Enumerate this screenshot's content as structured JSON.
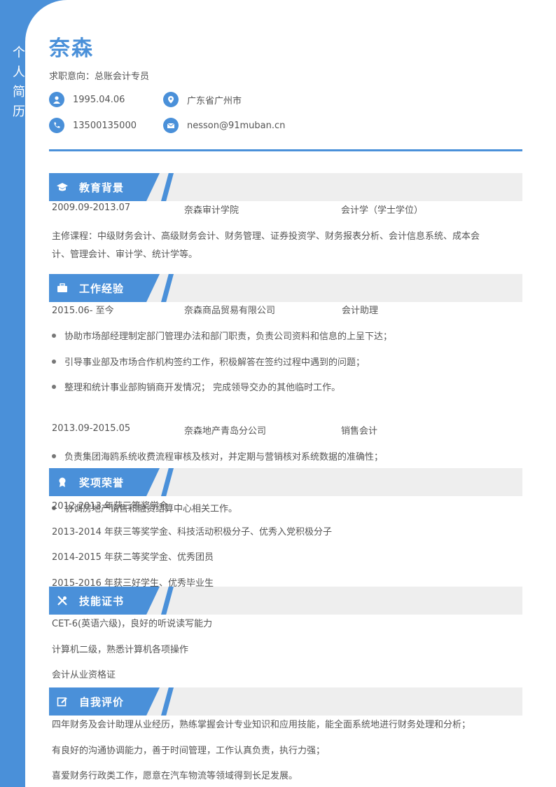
{
  "sidebar": {
    "title": [
      "个",
      "人",
      "简",
      "历"
    ]
  },
  "header": {
    "name": "奈森",
    "objective": "求职意向：总账会计专员",
    "birth": "1995.04.06",
    "location": "广东省广州市",
    "phone": "13500135000",
    "email": "nesson@91muban.cn",
    "accent": "#4a90d9"
  },
  "education": {
    "title": "教育背景",
    "period": "2009.09-2013.07",
    "school": "奈森审计学院",
    "major": "会计学（学士学位）",
    "courses_line1": "主修课程：中级财务会计、高级财务会计、财务管理、证券投资学、财务报表分析、会计信息系统、成本会",
    "courses_line2": "计、管理会计、审计学、统计学等。"
  },
  "work": {
    "title": "工作经验",
    "jobs": [
      {
        "period": "2015.06- 至今",
        "company": "奈森商品贸易有限公司",
        "role": "会计助理",
        "duties": [
          "协助市场部经理制定部门管理办法和部门职责，负责公司资料和信息的上呈下达；",
          "引导事业部及市场合作机构签约工作，积极解答在签约过程中遇到的问题；",
          "整理和统计事业部购销商开发情况；  完成领导交办的其他临时工作。"
        ]
      },
      {
        "period": "2013.09-2015.05",
        "company": "奈森地产青岛分公司",
        "role": "销售会计",
        "duties": [
          "负责集团海鸥系统收费流程审核及核对，并定期与营销核对系统数据的准确性；",
          "协调房地产销售和融资结算中心相关工作。"
        ]
      }
    ]
  },
  "awards": {
    "title": "奖项荣誉",
    "items": [
      "2012-2013 年获三等奖学金",
      "2013-2014 年获三等奖学金、科技活动积极分子、优秀入党积极分子",
      "2014-2015 年获二等奖学金、优秀团员",
      "2015-2016 年获三好学生、优秀毕业生"
    ]
  },
  "skills": {
    "title": "技能证书",
    "items": [
      "CET-6(英语六级)，良好的听说读写能力",
      "计算机二级，熟悉计算机各项操作",
      "会计从业资格证"
    ]
  },
  "self": {
    "title": "自我评价",
    "items": [
      "四年财务及会计助理从业经历，熟练掌握会计专业知识和应用技能，能全面系统地进行财务处理和分析；",
      "有良好的沟通协调能力，善于时间管理，工作认真负责，执行力强；",
      "喜爱财务行政类工作，愿意在汽车物流等领域得到长足发展。"
    ]
  }
}
